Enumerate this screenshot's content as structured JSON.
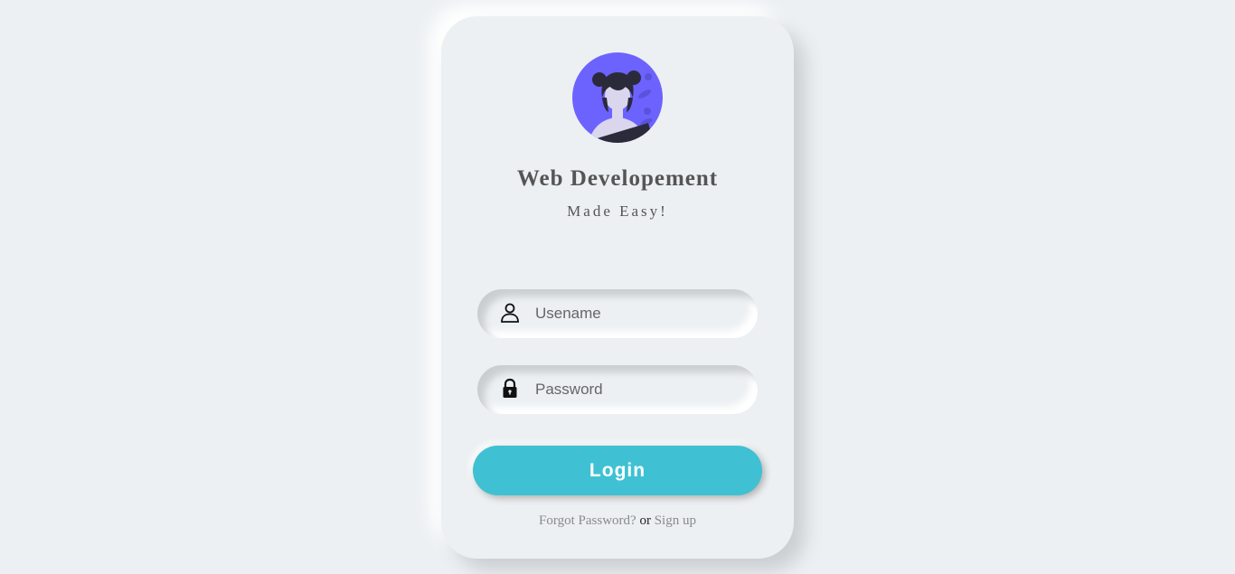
{
  "header": {
    "title": "Web Developement",
    "subtitle": "Made Easy!"
  },
  "form": {
    "username": {
      "placeholder": "Usename",
      "value": "",
      "icon": "user-icon"
    },
    "password": {
      "placeholder": "Password",
      "value": "",
      "icon": "lock-icon"
    },
    "login_label": "Login"
  },
  "footer": {
    "forgot_label": "Forgot Password?",
    "separator": "or",
    "signup_label": "Sign up"
  },
  "colors": {
    "background": "#ecf0f3",
    "accent": "#3fc1d3",
    "avatar_bg": "#6c63ff"
  }
}
